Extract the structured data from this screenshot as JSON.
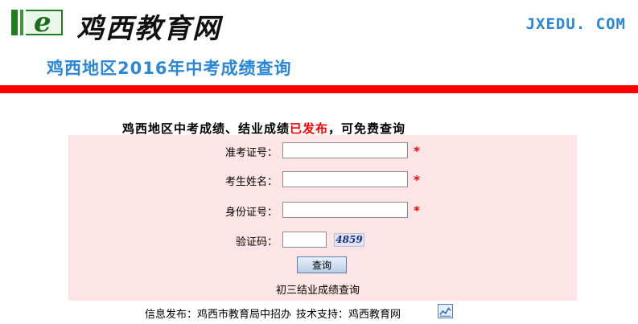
{
  "header": {
    "brand_name": "鸡西教育网",
    "site_url": "JXEDU. COM",
    "logo_letter": "e"
  },
  "page_title": "鸡西地区2016年中考成绩查询",
  "announcement": {
    "prefix": "鸡西地区中考成绩、结业成绩",
    "highlight": "已发布",
    "suffix": "，可免费查询"
  },
  "form": {
    "exam_number_label": "准考证号：",
    "exam_number_value": "",
    "name_label": "考生姓名：",
    "name_value": "",
    "id_label": "身份证号：",
    "id_value": "",
    "code_label": "验证码：",
    "code_value": "",
    "captcha_text": "4859",
    "required_mark": "*",
    "query_button": "查询",
    "junior_link": "初三结业成绩查询"
  },
  "footer": {
    "info_label": "信息发布：鸡西市教育局中招办",
    "tech_label": "技术支持：鸡西教育网"
  },
  "colors": {
    "accent_blue": "#2a86d6",
    "red_bar": "#ff0000",
    "panel_bg": "#fde4e6",
    "logo_green": "#1f7f1f"
  }
}
